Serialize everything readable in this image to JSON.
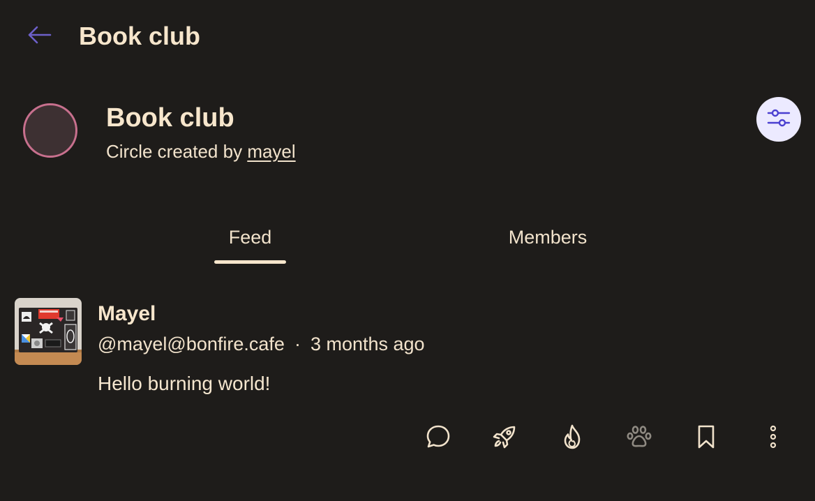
{
  "topbar": {
    "title": "Book club",
    "back_icon": "arrow-left-icon"
  },
  "circle": {
    "name": "Book club",
    "created_prefix": "Circle created by ",
    "creator": "mayel",
    "settings_icon": "sliders-icon"
  },
  "tabs": {
    "items": [
      {
        "label": "Feed",
        "active": true
      },
      {
        "label": "Members",
        "active": false
      }
    ]
  },
  "post": {
    "author": "Mayel",
    "handle": "@mayel@bonfire.cafe",
    "separator": "·",
    "time": "3 months ago",
    "content": "Hello burning world!",
    "actions": [
      "reply-icon",
      "boost-rocket-icon",
      "flame-like-icon",
      "paw-icon",
      "bookmark-icon",
      "more-vertical-icon"
    ]
  },
  "colors": {
    "background": "#1e1c1a",
    "text": "#f7e6cc",
    "accent": "#5b4fd6",
    "avatar_ring": "#c8708e",
    "settings_bg": "#eceaff",
    "muted_icon": "#8f8a82"
  }
}
